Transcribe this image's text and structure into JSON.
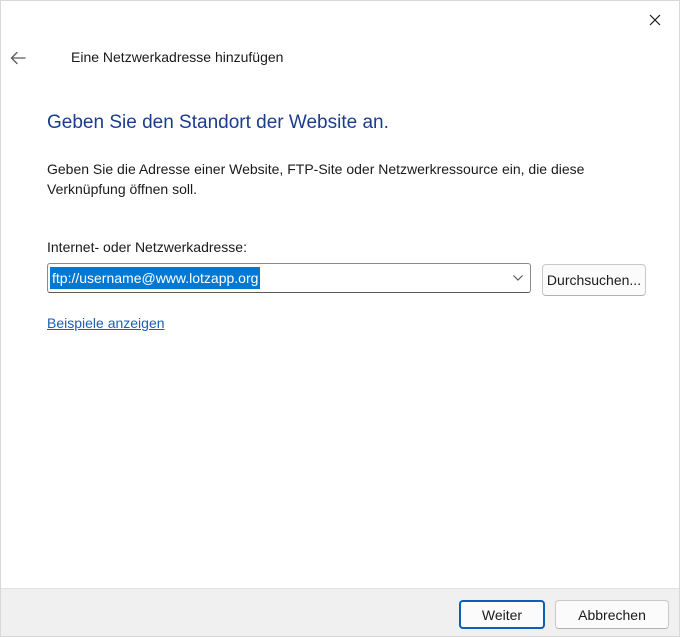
{
  "dialog": {
    "title": "Eine Netzwerkadresse hinzufügen",
    "heading": "Geben Sie den Standort der Website an.",
    "description": "Geben Sie die Adresse einer Website, FTP-Site oder Netzwerkressource ein, die diese Verknüpfung öffnen soll.",
    "field_label": "Internet- oder Netzwerkadresse:",
    "address_value": "ftp://username@www.lotzapp.org",
    "browse_label": "Durchsuchen...",
    "examples_link": "Beispiele anzeigen"
  },
  "footer": {
    "next_label": "Weiter",
    "cancel_label": "Abbrechen"
  },
  "icons": {
    "close": "close-icon",
    "back": "back-arrow-icon",
    "dropdown": "chevron-down-icon"
  },
  "colors": {
    "heading": "#1b3d8f",
    "link": "#1a5fb4",
    "selection": "#0078d4",
    "primary_border": "#0a5fb8",
    "footer_bg": "#f0f0f0"
  }
}
